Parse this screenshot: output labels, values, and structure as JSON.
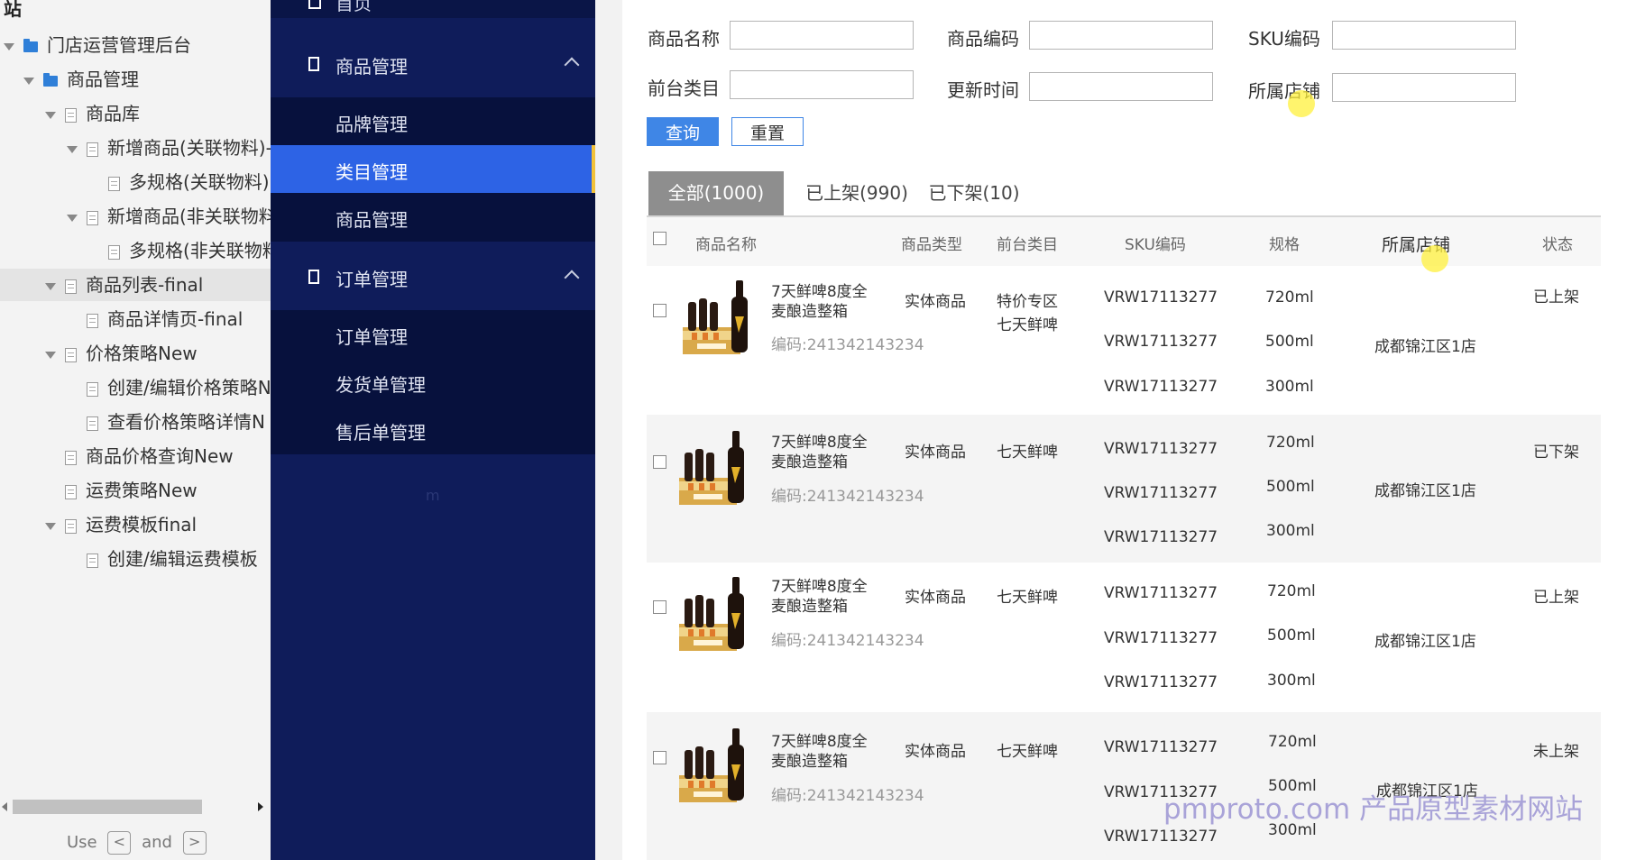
{
  "tree": {
    "site_label": "站",
    "nodes": [
      {
        "label": "门店运营管理后台",
        "kind": "folder",
        "expanded": true
      },
      {
        "label": "商品管理",
        "kind": "folder",
        "expanded": true
      },
      {
        "label": "商品库",
        "kind": "doc",
        "expanded": true
      },
      {
        "label": "新增商品(关联物料)-",
        "kind": "doc",
        "expanded": true
      },
      {
        "label": "多规格(关联物料)",
        "kind": "doc",
        "expanded": false
      },
      {
        "label": "新增商品(非关联物料",
        "kind": "doc",
        "expanded": true
      },
      {
        "label": "多规格(非关联物料",
        "kind": "doc",
        "expanded": false
      },
      {
        "label": "商品列表-final",
        "kind": "doc",
        "expanded": true
      },
      {
        "label": "商品详情页-final",
        "kind": "doc",
        "expanded": false
      },
      {
        "label": "价格策略New",
        "kind": "doc",
        "expanded": true
      },
      {
        "label": "创建/编辑价格策略N",
        "kind": "doc",
        "expanded": false
      },
      {
        "label": "查看价格策略详情N",
        "kind": "doc",
        "expanded": false
      },
      {
        "label": "商品价格查询New",
        "kind": "doc",
        "expanded": false
      },
      {
        "label": "运费策略New",
        "kind": "doc",
        "expanded": false
      },
      {
        "label": "运费模板final",
        "kind": "doc",
        "expanded": true
      },
      {
        "label": "创建/编辑运费模板",
        "kind": "doc",
        "expanded": false
      }
    ],
    "hint": {
      "use": "Use",
      "key_prev": "<",
      "and": "and",
      "key_next": ">"
    }
  },
  "nav": {
    "top_cut_label": "首页",
    "groups": [
      {
        "label": "商品管理",
        "items": [
          "品牌管理",
          "类目管理",
          "商品管理"
        ],
        "active": "类目管理"
      },
      {
        "label": "订单管理",
        "items": [
          "订单管理",
          "发货单管理",
          "售后单管理"
        ]
      }
    ],
    "faint_text": "m"
  },
  "filters": {
    "product_name": {
      "label": "商品名称",
      "value": ""
    },
    "product_code": {
      "label": "商品编码",
      "value": ""
    },
    "sku_code": {
      "label": "SKU编码",
      "value": ""
    },
    "front_category": {
      "label": "前台类目",
      "value": ""
    },
    "update_time": {
      "label": "更新时间",
      "value": ""
    },
    "store": {
      "label": "所属店铺",
      "value": ""
    },
    "query_label": "查询",
    "reset_label": "重置"
  },
  "tabs": [
    {
      "label": "全部(1000)",
      "active": true
    },
    {
      "label": "已上架(990)",
      "active": false
    },
    {
      "label": "已下架(10)",
      "active": false
    }
  ],
  "table": {
    "headers": {
      "name": "商品名称",
      "type": "商品类型",
      "category": "前台类目",
      "sku": "SKU编码",
      "spec": "规格",
      "store": "所属店铺",
      "status": "状态"
    },
    "rows": [
      {
        "name_line1": "7天鲜啤8度全",
        "name_line2": "麦酿造整箱",
        "code": "编码:241342143234",
        "type": "实体商品",
        "category_line1": "特价专区",
        "category_line2": "七天鲜啤",
        "skus": [
          "VRW17113277",
          "VRW17113277",
          "VRW17113277"
        ],
        "specs": [
          "720ml",
          "500ml",
          "300ml"
        ],
        "store": "成都锦江区1店",
        "status": "已上架"
      },
      {
        "name_line1": "7天鲜啤8度全",
        "name_line2": "麦酿造整箱",
        "code": "编码:241342143234",
        "type": "实体商品",
        "category_line1": "七天鲜啤",
        "category_line2": "",
        "skus": [
          "VRW17113277",
          "VRW17113277",
          "VRW17113277"
        ],
        "specs": [
          "720ml",
          "500ml",
          "300ml"
        ],
        "store": "成都锦江区1店",
        "status": "已下架"
      },
      {
        "name_line1": "7天鲜啤8度全",
        "name_line2": "麦酿造整箱",
        "code": "编码:241342143234",
        "type": "实体商品",
        "category_line1": "七天鲜啤",
        "category_line2": "",
        "skus": [
          "VRW17113277",
          "VRW17113277",
          "VRW17113277"
        ],
        "specs": [
          "720ml",
          "500ml",
          "300ml"
        ],
        "store": "成都锦江区1店",
        "status": "已上架"
      },
      {
        "name_line1": "7天鲜啤8度全",
        "name_line2": "麦酿造整箱",
        "code": "编码:241342143234",
        "type": "实体商品",
        "category_line1": "七天鲜啤",
        "category_line2": "",
        "skus": [
          "VRW17113277",
          "VRW17113277",
          "VRW17113277"
        ],
        "specs": [
          "720ml",
          "500ml",
          "300ml"
        ],
        "store": "成都锦江区1店",
        "status": "未上架"
      }
    ]
  },
  "watermark": "pmproto.com 产品原型素材网站",
  "colors": {
    "nav_bg": "#0f1c5a",
    "nav_sub_bg": "#07113d",
    "nav_active": "#2d63e5",
    "primary_button": "#3f86e6",
    "active_tab": "#8e8e8e"
  }
}
